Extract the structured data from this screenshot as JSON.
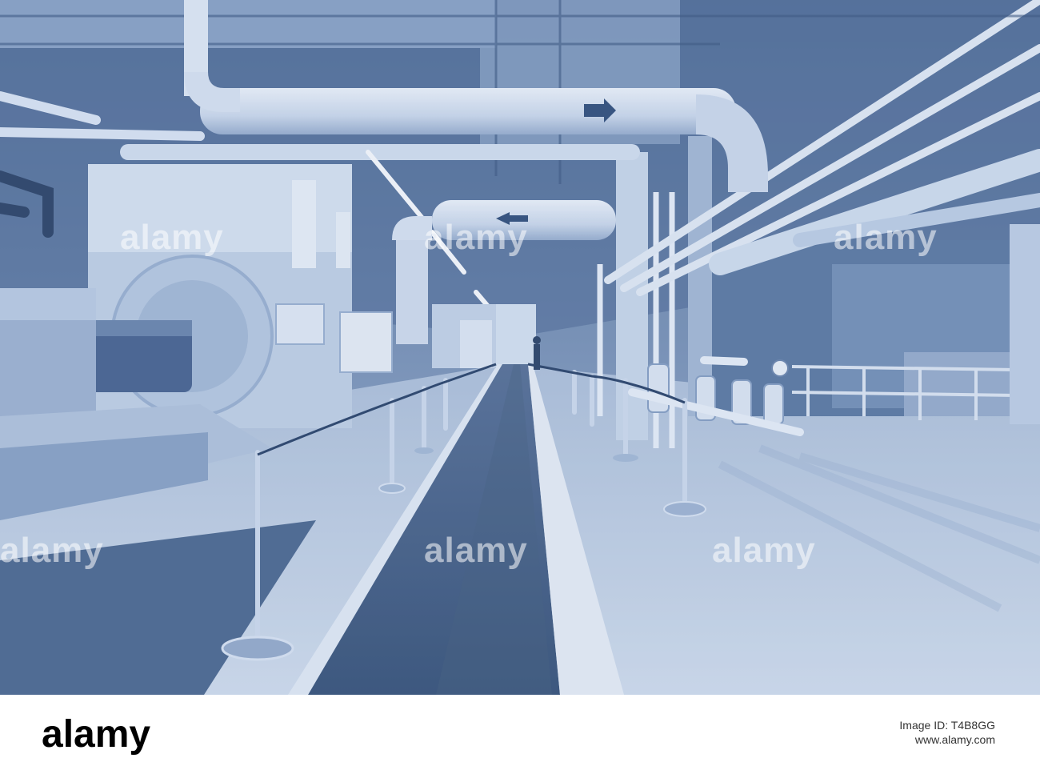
{
  "watermark": "alamy",
  "footer": {
    "brand": "alamy",
    "image_id": "Image ID: T4B8GG",
    "url": "www.alamy.com"
  },
  "palette": {
    "shadow": "#2f4a72",
    "mid": "#7d97bd",
    "light": "#c9d6e8",
    "pipe": "#e6eef8"
  }
}
